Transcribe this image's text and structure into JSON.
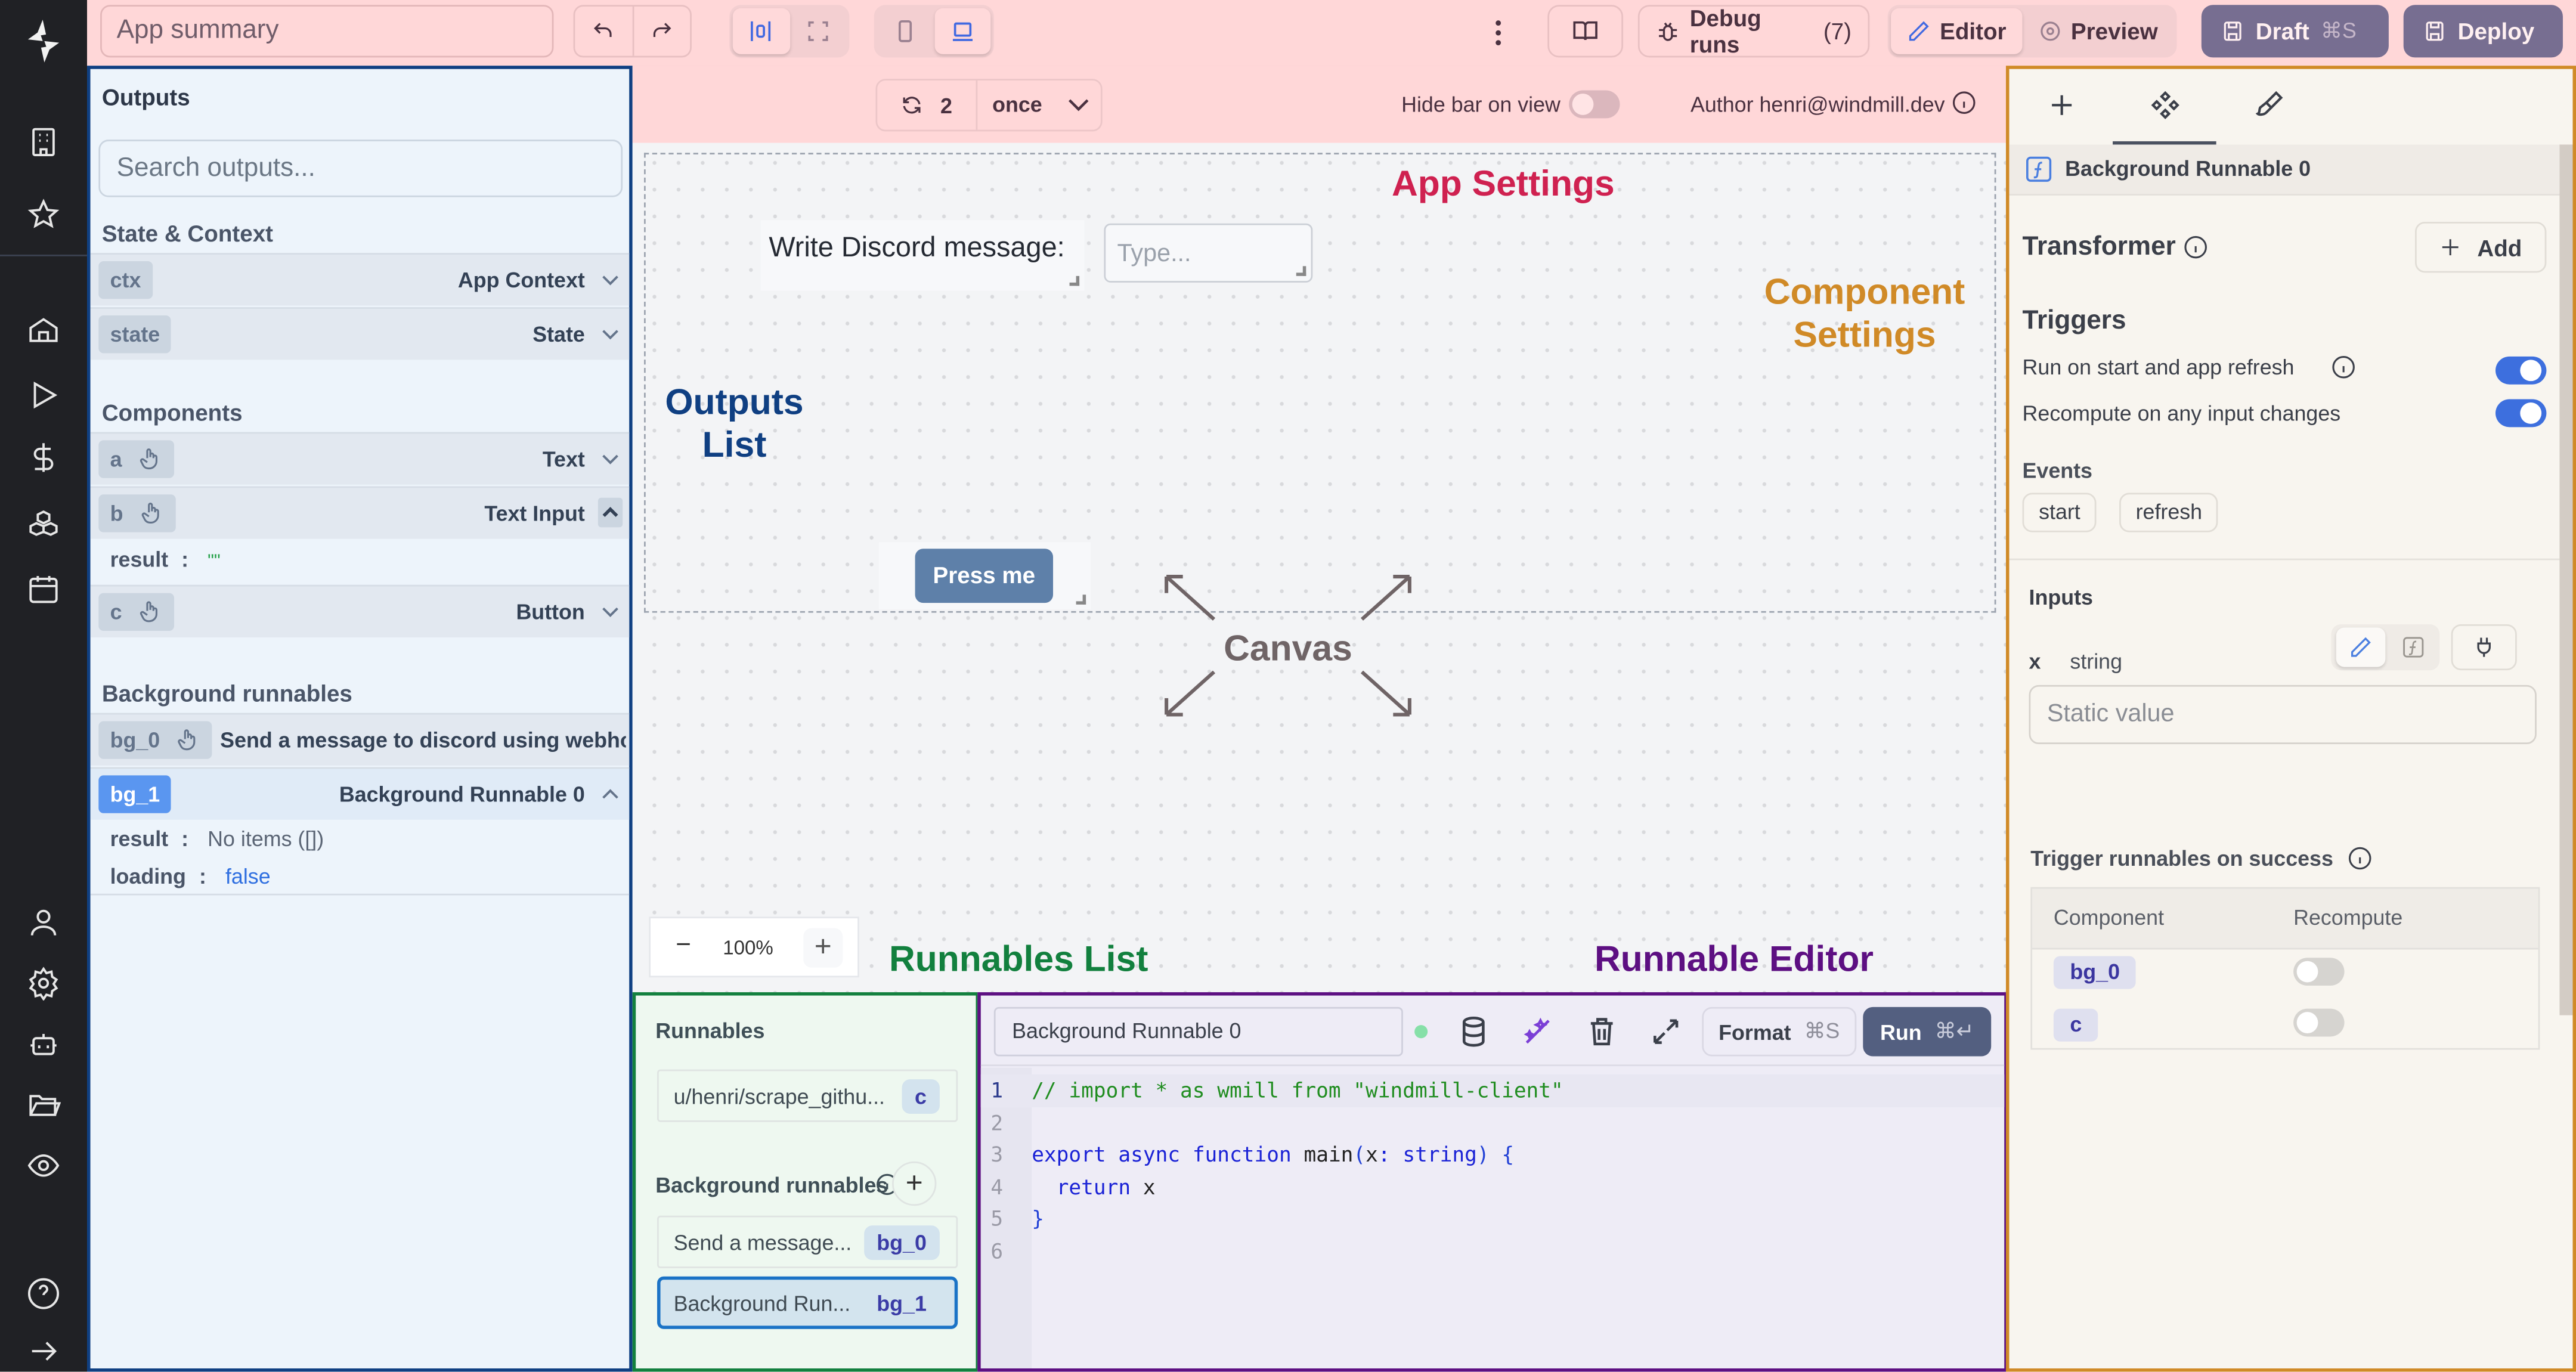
{
  "topbar": {
    "app_summary_placeholder": "App summary",
    "debug_runs_label": "Debug runs",
    "debug_runs_count": "(7)",
    "editor_label": "Editor",
    "preview_label": "Preview",
    "draft_label": "Draft",
    "draft_shortcut": "⌘S",
    "deploy_label": "Deploy",
    "active_mode": "Editor",
    "active_device": "desktop"
  },
  "sidebar": {
    "items": [
      {
        "icon": "building-icon"
      },
      {
        "icon": "star-icon"
      },
      {
        "icon": "home-icon"
      },
      {
        "icon": "play-icon"
      },
      {
        "icon": "dollar-icon"
      },
      {
        "icon": "boxes-icon"
      },
      {
        "icon": "calendar-icon"
      },
      {
        "icon": "user-icon"
      },
      {
        "icon": "settings-icon"
      },
      {
        "icon": "bot-icon"
      },
      {
        "icon": "folder-icon"
      },
      {
        "icon": "eye-icon"
      },
      {
        "icon": "help-icon"
      },
      {
        "icon": "expand-arrow-icon"
      }
    ]
  },
  "outputs": {
    "title": "Outputs",
    "search_placeholder": "Search outputs...",
    "state_context_title": "State & Context",
    "state_rows": [
      {
        "id": "ctx",
        "label": "App Context"
      },
      {
        "id": "state",
        "label": "State"
      }
    ],
    "components_title": "Components",
    "components": [
      {
        "id": "a",
        "label": "Text",
        "expanded": false
      },
      {
        "id": "b",
        "label": "Text Input",
        "expanded": true,
        "result_key": "result",
        "result_value": "\"\""
      },
      {
        "id": "c",
        "label": "Button",
        "expanded": false
      }
    ],
    "background_title": "Background runnables",
    "background": [
      {
        "id": "bg_0",
        "label": "Send a message to discord using webhoo"
      },
      {
        "id": "bg_1",
        "label": "Background Runnable 0",
        "expanded": true,
        "result_key": "result",
        "result_value": "No items ([])",
        "loading_key": "loading",
        "loading_value": "false"
      }
    ]
  },
  "canvas_header": {
    "refresh_count": "2",
    "refresh_mode": "once",
    "hide_bar_label": "Hide bar on view",
    "hide_bar_on": false,
    "author_label": "Author henri@windmill.dev"
  },
  "canvas": {
    "text_component": "Write Discord message:",
    "input_placeholder": "Type...",
    "button_label": "Press me",
    "zoom_level": "100%",
    "annotations": {
      "app_settings": "App Settings",
      "component_settings": "Component Settings",
      "outputs_list": "Outputs List",
      "canvas": "Canvas",
      "runnables_list": "Runnables List",
      "runnable_editor": "Runnable Editor"
    },
    "annotation_colors": {
      "app_settings": "#cf2150",
      "component_settings": "#d08a27",
      "outputs_list": "#0f3f82",
      "canvas": "#6f6466",
      "runnables_list": "#12803e",
      "runnable_editor": "#5d0f82"
    }
  },
  "runnables": {
    "title": "Runnables",
    "items": [
      {
        "label": "u/henri/scrape_githu...",
        "badge": "c"
      }
    ],
    "background_title": "Background runnables",
    "background_items": [
      {
        "label": "Send a message...",
        "badge": "bg_0",
        "selected": false
      },
      {
        "label": "Background Run...",
        "badge": "bg_1",
        "selected": true
      }
    ]
  },
  "editor": {
    "runnable_name": "Background Runnable 0",
    "format_label": "Format",
    "format_shortcut": "⌘S",
    "run_label": "Run",
    "run_shortcut": "⌘↵",
    "status_color": "#86e0a8",
    "code_lines": [
      {
        "n": "1",
        "text": "// import * as wmill from \"windmill-client\""
      },
      {
        "n": "2",
        "text": ""
      },
      {
        "n": "3",
        "text": "export async function main(x: string) {"
      },
      {
        "n": "4",
        "text": "  return x"
      },
      {
        "n": "5",
        "text": "}"
      },
      {
        "n": "6",
        "text": ""
      }
    ]
  },
  "settings": {
    "header_title": "Background Runnable 0",
    "transformer_label": "Transformer",
    "add_label": "Add",
    "triggers_title": "Triggers",
    "trigger_run_on_start": "Run on start and app refresh",
    "trigger_run_on_start_on": true,
    "trigger_recompute": "Recompute on any input changes",
    "trigger_recompute_on": true,
    "events_title": "Events",
    "events": [
      "start",
      "refresh"
    ],
    "inputs_title": "Inputs",
    "input_name": "x",
    "input_type": "string",
    "input_placeholder": "Static value",
    "trigger_success_title": "Trigger runnables on success",
    "table_headers": [
      "Component",
      "Recompute"
    ],
    "table_rows": [
      {
        "component": "bg_0",
        "recompute": false
      },
      {
        "component": "c",
        "recompute": false
      }
    ]
  }
}
